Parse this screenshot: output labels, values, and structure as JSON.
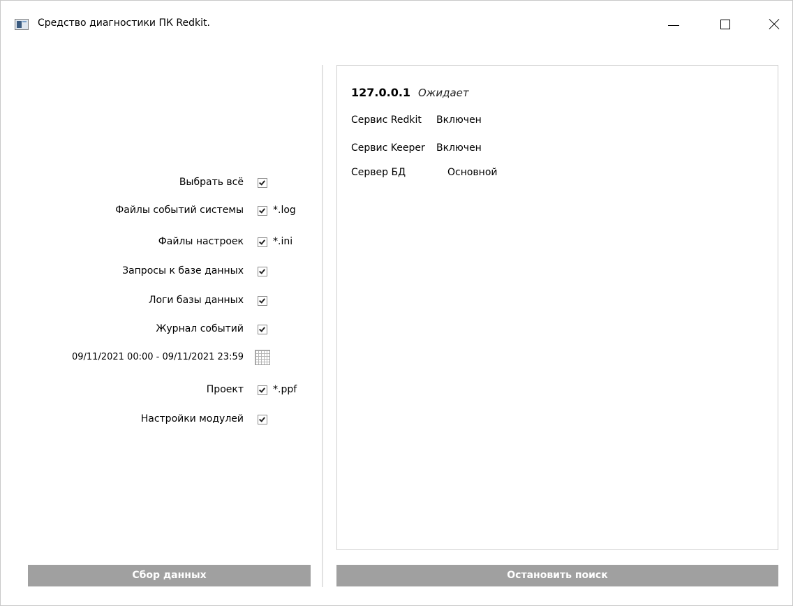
{
  "window": {
    "title": "Средство диагностики ПК Redkit.",
    "icon": "app-window-icon",
    "controls": [
      "minimize-icon",
      "maximize-icon",
      "close-icon"
    ]
  },
  "options": [
    {
      "label": "Выбрать всё",
      "checked": true
    },
    {
      "label": "Файлы событий системы",
      "checked": true,
      "ext": "*.log"
    },
    {
      "label": "Файлы настроек",
      "checked": true,
      "ext": "*.ini"
    },
    {
      "label": "Запросы к базе данных",
      "checked": true
    },
    {
      "label": "Логи базы данных",
      "checked": true
    },
    {
      "label": "Журнал событий",
      "checked": true
    },
    {
      "label": "Проект",
      "checked": true,
      "ext": "*.ppf"
    },
    {
      "label": "Настройки модулей",
      "checked": true
    }
  ],
  "date_range": "09/11/2021 00:00 - 09/11/2021 23:59",
  "panel": {
    "host": "127.0.0.1",
    "host_status": "Ожидает",
    "rows": [
      {
        "key": "Сервис Redkit",
        "value": "Включен"
      },
      {
        "key": "Сервис Keeper",
        "value": "Включен"
      },
      {
        "key": "Сервер БД",
        "value": "Основной"
      }
    ]
  },
  "buttons": {
    "collect": "Сбор данных",
    "stop": "Остановить поиск"
  },
  "colors": {
    "button_bg": "#a0a0a0",
    "button_text": "#ffffff"
  }
}
